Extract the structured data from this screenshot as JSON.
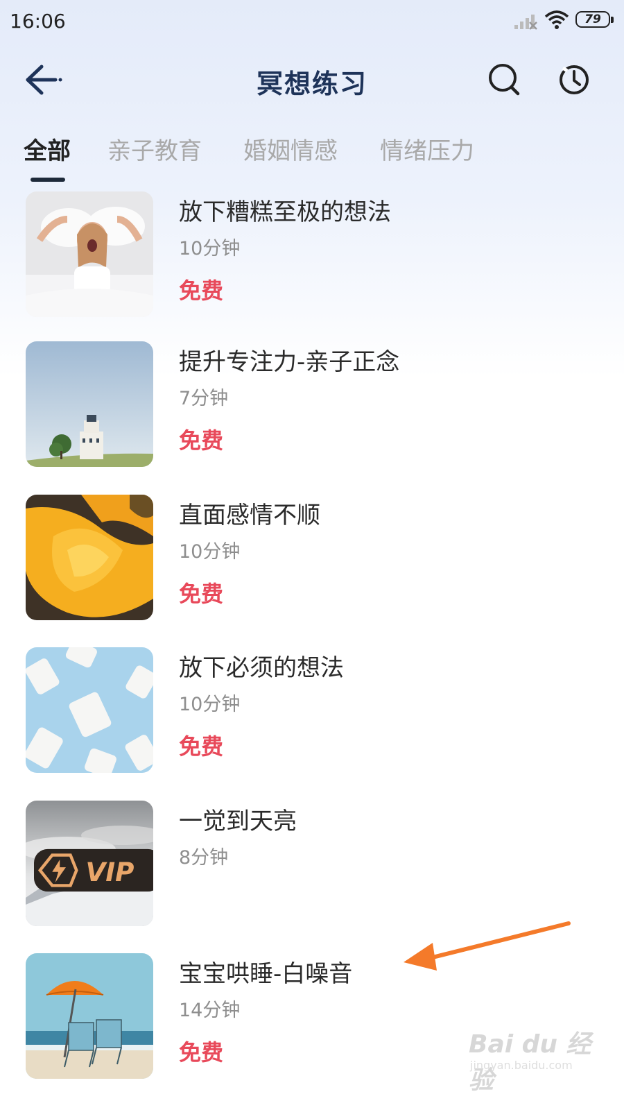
{
  "status_bar": {
    "time": "16:06",
    "battery": "79"
  },
  "header": {
    "title": "冥想练习"
  },
  "tabs": [
    {
      "label": "全部",
      "active": true
    },
    {
      "label": "亲子教育",
      "active": false
    },
    {
      "label": "婚姻情感",
      "active": false
    },
    {
      "label": "情绪压力",
      "active": false
    }
  ],
  "items": [
    {
      "title": "放下糟糕至极的想法",
      "duration": "10分钟",
      "price": "免费"
    },
    {
      "title": "提升专注力-亲子正念",
      "duration": "7分钟",
      "price": "免费"
    },
    {
      "title": "直面感情不顺",
      "duration": "10分钟",
      "price": "免费"
    },
    {
      "title": "放下必须的想法",
      "duration": "10分钟",
      "price": "免费"
    },
    {
      "title": "一觉到天亮",
      "duration": "8分钟",
      "badge": "VIP"
    },
    {
      "title": "宝宝哄睡-白噪音",
      "duration": "14分钟",
      "price": "免费"
    }
  ],
  "watermark": {
    "main": "Bai du 经验",
    "sub": "jingyan.baidu.com"
  },
  "colors": {
    "title": "#1e3359",
    "price": "#e8495a",
    "arrow": "#f47a2a",
    "tab_active": "#222222",
    "tab_inactive": "#a9a9a9"
  }
}
